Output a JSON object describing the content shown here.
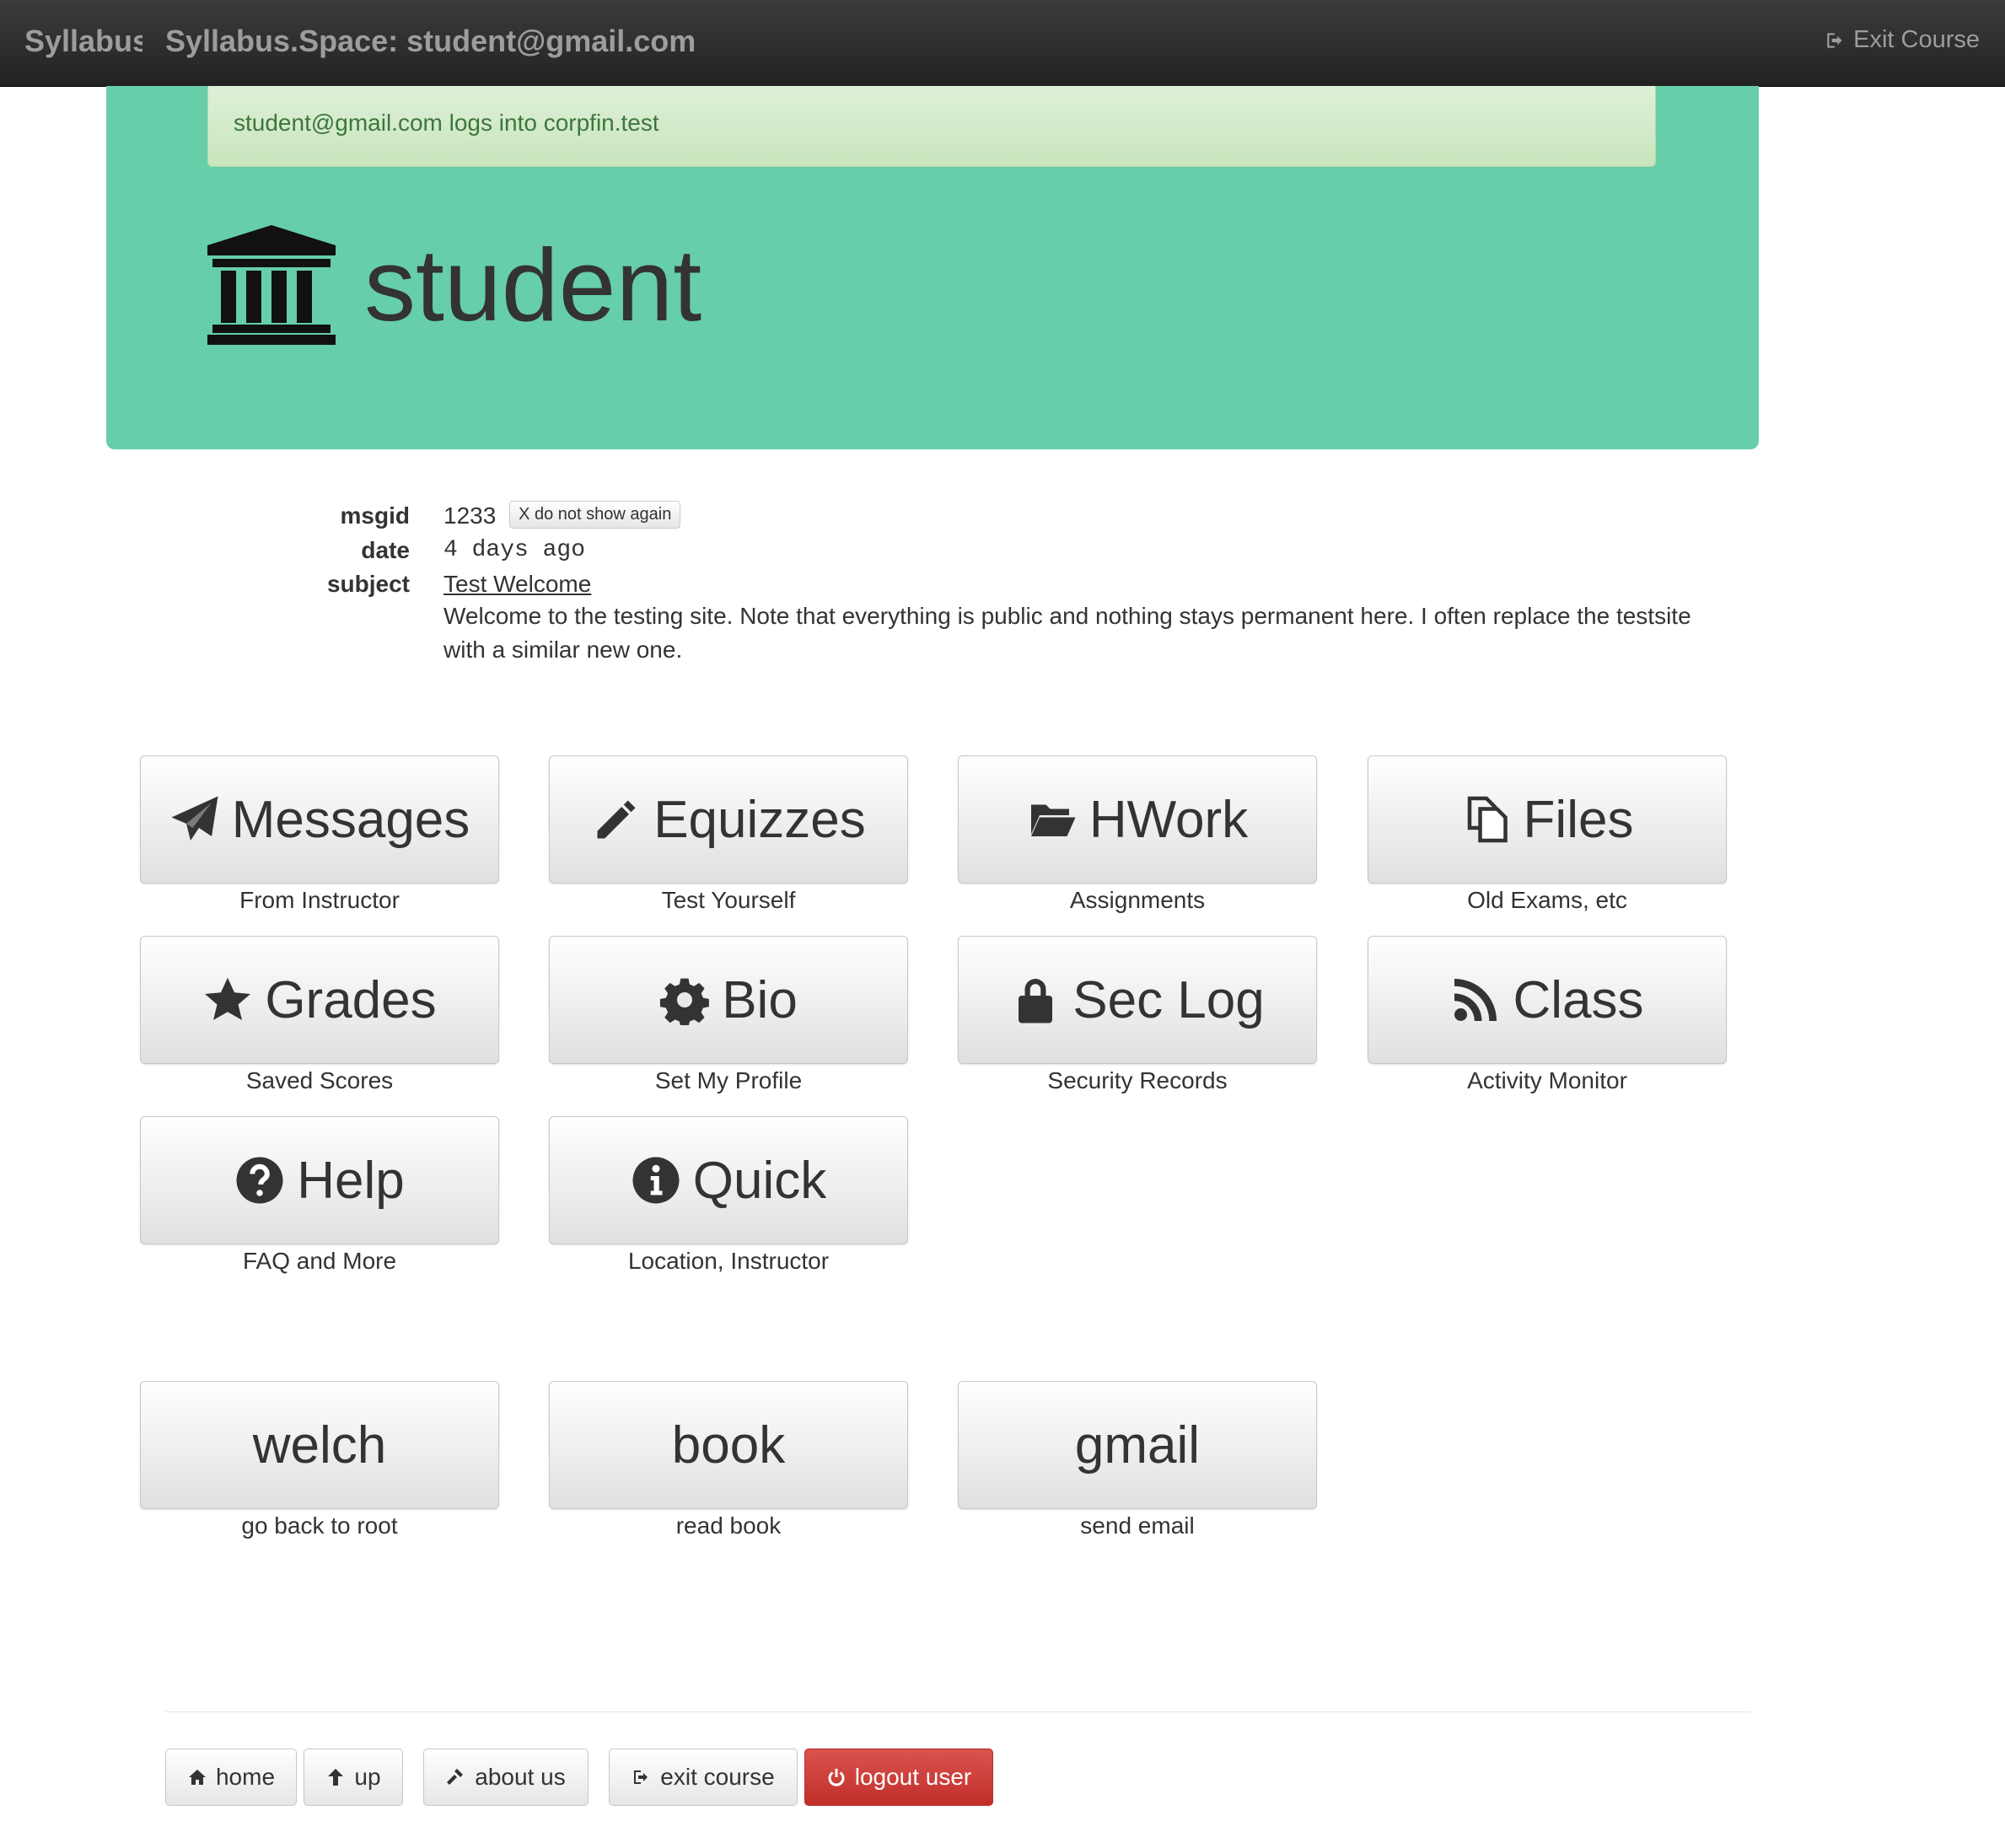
{
  "navbar": {
    "brand": "Syllabus.Space",
    "title": "Syllabus.Space: student@gmail.com",
    "exit_label": "Exit Course"
  },
  "alert": {
    "text": "student@gmail.com logs into corpfin.test"
  },
  "hero": {
    "title": "student",
    "icon": "bank-icon"
  },
  "message": {
    "msgid_label": "msgid",
    "msgid_value": "1233",
    "dismiss_label": "X do not show again",
    "date_label": "date",
    "date_value": "4 days ago",
    "subject_label": "subject",
    "subject_value": "Test Welcome",
    "body": "Welcome to the testing site. Note that everything is public and nothing stays permanent here. I often replace the testsite with a similar new one."
  },
  "tiles": [
    {
      "label": "Messages",
      "sub": "From Instructor",
      "icon": "paper-plane-icon"
    },
    {
      "label": "Equizzes",
      "sub": "Test Yourself",
      "icon": "pencil-icon"
    },
    {
      "label": "HWork",
      "sub": "Assignments",
      "icon": "folder-open-icon"
    },
    {
      "label": "Files",
      "sub": "Old Exams, etc",
      "icon": "files-icon"
    },
    {
      "label": "Grades",
      "sub": "Saved Scores",
      "icon": "star-icon"
    },
    {
      "label": "Bio",
      "sub": "Set My Profile",
      "icon": "gear-icon"
    },
    {
      "label": "Sec Log",
      "sub": "Security Records",
      "icon": "lock-icon"
    },
    {
      "label": "Class",
      "sub": "Activity Monitor",
      "icon": "rss-icon"
    },
    {
      "label": "Help",
      "sub": "FAQ and More",
      "icon": "question-circle-icon"
    },
    {
      "label": "Quick",
      "sub": "Location, Instructor",
      "icon": "info-circle-icon"
    }
  ],
  "links": [
    {
      "label": "welch",
      "sub": "go back to root"
    },
    {
      "label": "book",
      "sub": "read book"
    },
    {
      "label": "gmail",
      "sub": "send email"
    }
  ],
  "footer": {
    "home": "home",
    "up": "up",
    "about": "about us",
    "exit": "exit course",
    "logout": "logout user"
  },
  "colors": {
    "jumbotron": "#66cea9",
    "alert_text": "#3c763d",
    "danger": "#d9534f"
  }
}
